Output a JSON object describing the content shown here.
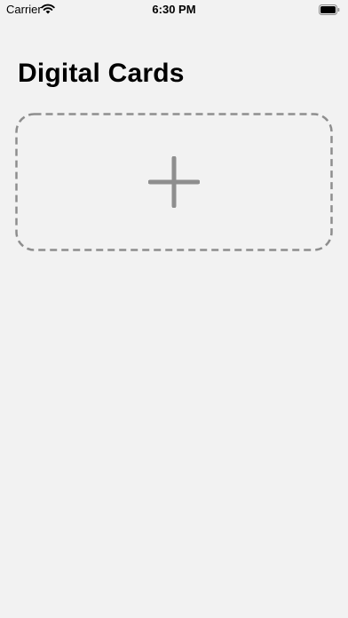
{
  "status_bar": {
    "carrier": "Carrier",
    "time": "6:30 PM",
    "wifi_icon": "wifi-icon",
    "battery_icon": "battery-icon"
  },
  "page": {
    "title": "Digital Cards"
  },
  "add_card": {
    "icon": "plus-icon",
    "border_color": "#8e8e8e",
    "icon_color": "#8e8e8e"
  },
  "colors": {
    "background": "#f2f2f2"
  }
}
